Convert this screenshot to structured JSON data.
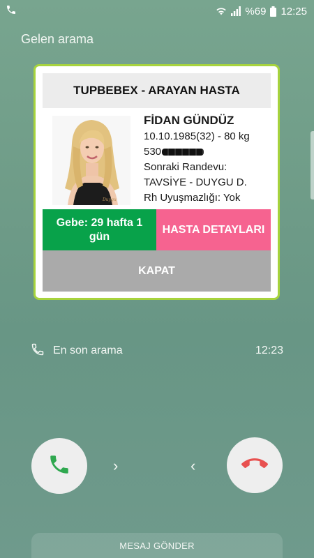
{
  "status_bar": {
    "battery": "%69",
    "time": "12:25"
  },
  "screen": {
    "title": "Gelen arama"
  },
  "card": {
    "header": "TUPBEBEX - ARAYAN HASTA",
    "patient": {
      "name": "FİDAN GÜNDÜZ",
      "dob_age_weight": "10.10.1985(32) - 80 kg",
      "phone_prefix": "530",
      "next_appointment_label": "Sonraki Randevu:",
      "next_appointment_value": "TAVSİYE - DUYGU D.",
      "rh": "Rh Uyuşmazlığı: Yok"
    },
    "pregnancy": "Gebe: 29    hafta 1 gün",
    "details_label": "HASTA DETAYLARI",
    "close_label": "KAPAT"
  },
  "last_call": {
    "label": "En son arama",
    "time": "12:23"
  },
  "controls": {
    "right_chevron": "›",
    "left_chevron": "‹"
  },
  "message_label": "MESAJ GÖNDER",
  "colors": {
    "card_border": "#a7d33d",
    "gebe_green": "#08a24a",
    "details_pink": "#f66390",
    "close_gray": "#aaaaaa",
    "answer_green": "#2fa84f",
    "decline_red": "#e8504f"
  }
}
